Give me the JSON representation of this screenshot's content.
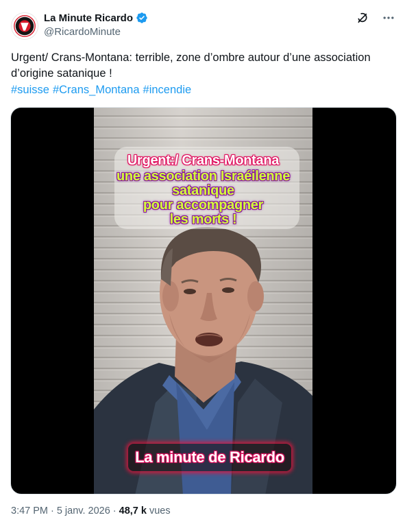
{
  "author": {
    "display_name": "La Minute Ricardo",
    "handle": "@RicardoMinute",
    "verified_icon": "verified-badge-icon",
    "verified_color": "#1d9bf0"
  },
  "header_icons": [
    "grok-icon",
    "more-options-icon"
  ],
  "tweet": {
    "text_line_1": "Urgent/ Crans-Montana: terrible, zone d’ombre autour d’une association",
    "text_line_2": "d’origine satanique !",
    "hashtags": [
      "#suisse",
      "#Crans_Montana",
      "#incendie"
    ],
    "hashtag_color": "#1d9bf0"
  },
  "video": {
    "overlay_lines": [
      "Urgent:/ Crans-Montana",
      "une association Israéilenne",
      "satanique",
      "pour accompagner",
      "les morts !"
    ],
    "bottom_caption": "La minute de Ricardo"
  },
  "footer": {
    "time": "3:47 PM",
    "separator": "·",
    "date": "5 janv. 2026",
    "views_count": "48,7 k",
    "views_label": "vues"
  }
}
